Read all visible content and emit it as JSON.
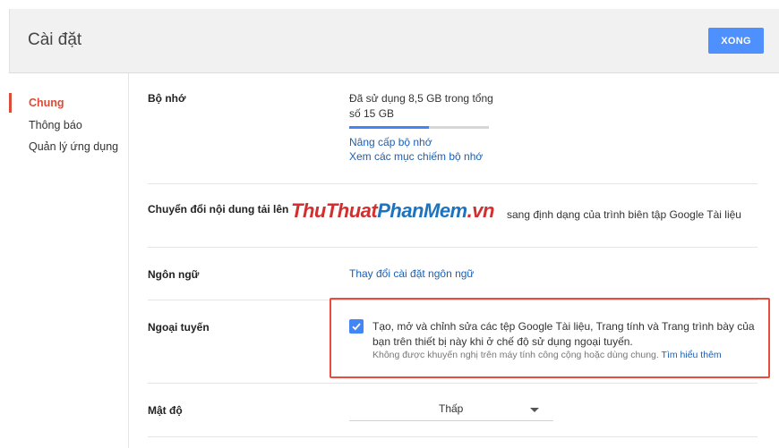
{
  "header": {
    "title": "Cài đặt",
    "done_label": "XONG"
  },
  "sidebar": {
    "items": [
      {
        "label": "Chung",
        "active": true
      },
      {
        "label": "Thông báo",
        "active": false
      },
      {
        "label": "Quản lý ứng dụng",
        "active": false
      }
    ]
  },
  "storage": {
    "label": "Bộ nhớ",
    "usage_text": "Đã sử dụng 8,5 GB trong tổng số 15 GB",
    "used_fraction": 0.57,
    "upgrade_link": "Nâng cấp bộ nhớ",
    "view_link": "Xem các mục chiếm bộ nhớ"
  },
  "convert": {
    "label": "Chuyển đổi nội dung tải lên",
    "text_visible": "sang định dạng của trình biên tập Google Tài liệu"
  },
  "watermark": {
    "part1": "ThuThuat",
    "part2": "PhanMem",
    "part3": ".vn"
  },
  "language": {
    "label": "Ngôn ngữ",
    "link": "Thay đổi cài đặt ngôn ngữ"
  },
  "offline": {
    "label": "Ngoại tuyến",
    "checked": true,
    "text": "Tạo, mở và chỉnh sửa các tệp Google Tài liệu, Trang tính và Trang trình bày của bạn trên thiết bị này khi ở chế độ sử dụng ngoại tuyến.",
    "note": "Không được khuyến nghị trên máy tính công cộng hoặc dùng chung.",
    "learn_more": "Tìm hiểu thêm"
  },
  "density": {
    "label": "Mật độ",
    "value": "Thấp"
  },
  "colors": {
    "accent": "#4285f4",
    "active": "#dd4b39",
    "highlight": "#e74c3c"
  }
}
